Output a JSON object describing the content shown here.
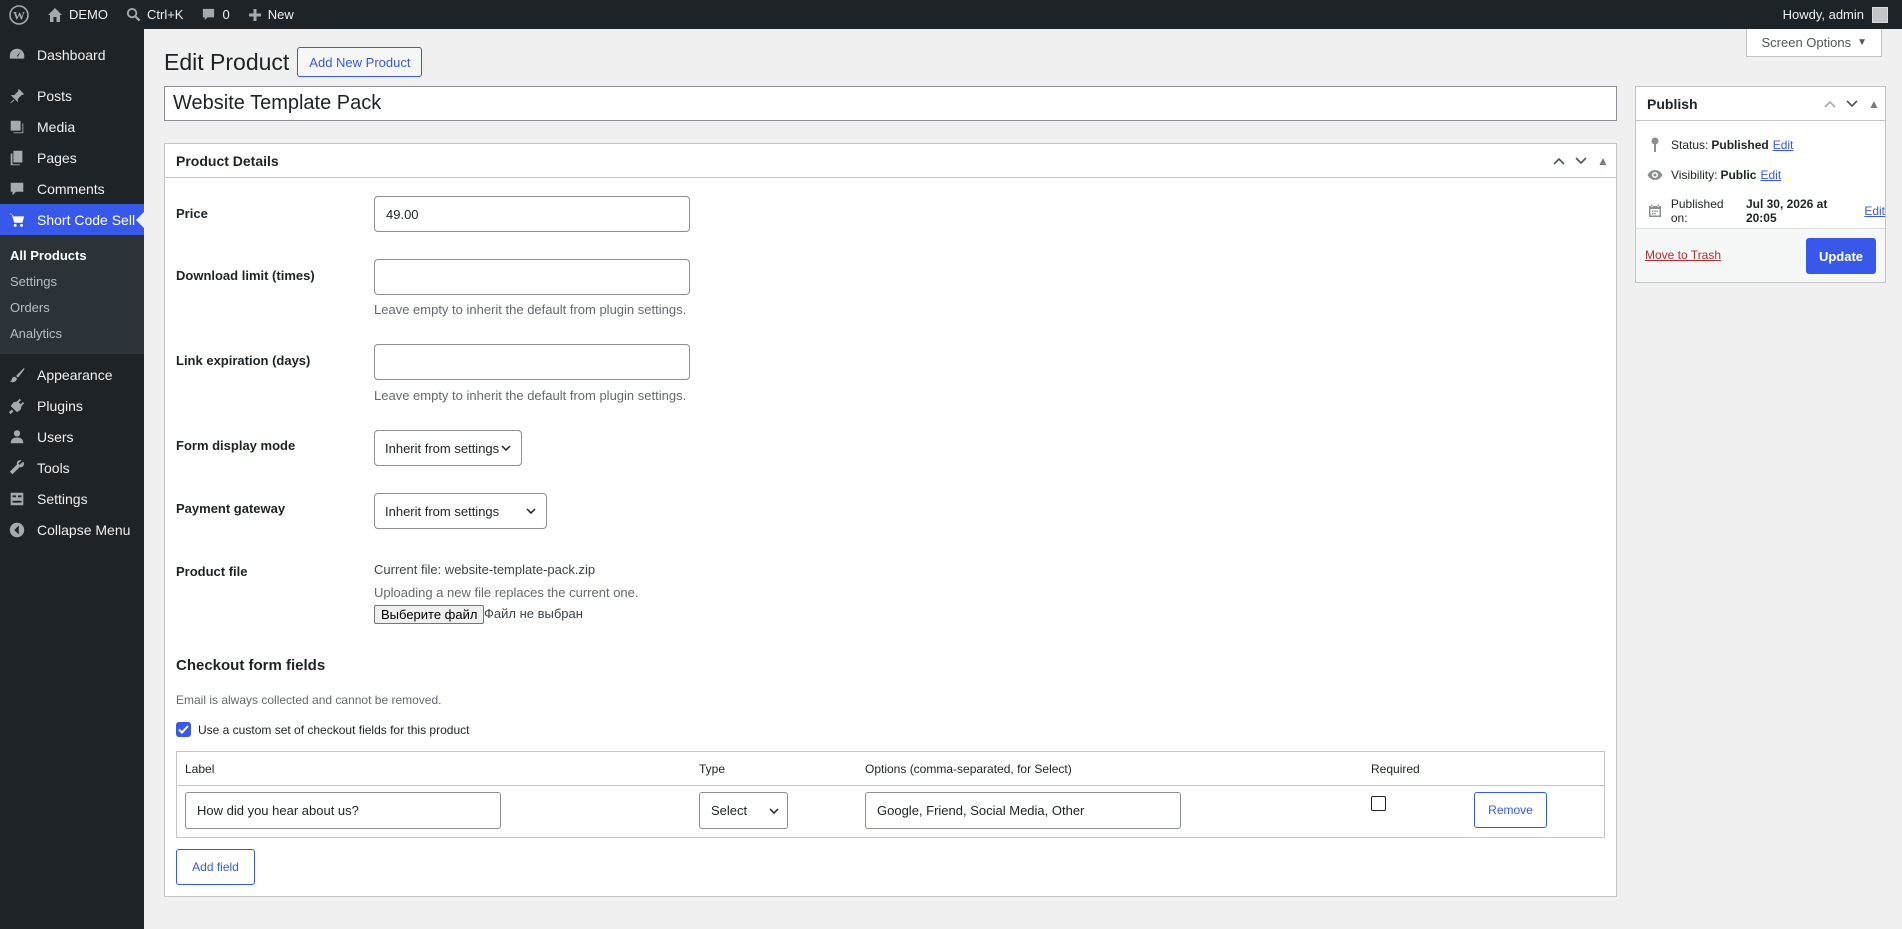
{
  "adminbar": {
    "site_name": "DEMO",
    "shortcut": "Ctrl+K",
    "comments_count": "0",
    "new_label": "New",
    "howdy": "Howdy, admin"
  },
  "sidebar": {
    "items": [
      {
        "label": "Dashboard",
        "icon": "dashboard-icon"
      },
      {
        "label": "Posts",
        "icon": "pin-icon"
      },
      {
        "label": "Media",
        "icon": "media-icon"
      },
      {
        "label": "Pages",
        "icon": "pages-icon"
      },
      {
        "label": "Comments",
        "icon": "comment-icon"
      },
      {
        "label": "Short Code Sell",
        "icon": "cart-icon"
      },
      {
        "label": "Appearance",
        "icon": "brush-icon"
      },
      {
        "label": "Plugins",
        "icon": "plugin-icon"
      },
      {
        "label": "Users",
        "icon": "users-icon"
      },
      {
        "label": "Tools",
        "icon": "wrench-icon"
      },
      {
        "label": "Settings",
        "icon": "settings-icon"
      },
      {
        "label": "Collapse Menu",
        "icon": "collapse-icon"
      }
    ],
    "submenu": [
      "All Products",
      "Settings",
      "Orders",
      "Analytics"
    ]
  },
  "screen_options": "Screen Options",
  "page": {
    "title": "Edit Product",
    "add_new": "Add New Product",
    "post_title": "Website Template Pack"
  },
  "details": {
    "header": "Product Details",
    "price_label": "Price",
    "price_value": "49.00",
    "download_label": "Download limit (times)",
    "download_desc": "Leave empty to inherit the default from plugin settings.",
    "expiration_label": "Link expiration (days)",
    "expiration_desc": "Leave empty to inherit the default from plugin settings.",
    "form_mode_label": "Form display mode",
    "form_mode_value": "Inherit from settings",
    "gateway_label": "Payment gateway",
    "gateway_value": "Inherit from settings",
    "file_label": "Product file",
    "current_file": "Current file: website-template-pack.zip",
    "file_note": "Uploading a new file replaces the current one.",
    "file_button": "Выберите файл",
    "file_none": "Файл не выбран"
  },
  "checkout": {
    "title": "Checkout form fields",
    "desc": "Email is always collected and cannot be removed.",
    "custom_checkbox": "Use a custom set of checkout fields for this product",
    "columns": [
      "Label",
      "Type",
      "Options (comma-separated, for Select)",
      "Required"
    ],
    "row": {
      "label": "How did you hear about us?",
      "type": "Select",
      "options": "Google, Friend, Social Media, Other",
      "remove": "Remove"
    },
    "add_field": "Add field"
  },
  "publish": {
    "header": "Publish",
    "status_label": "Status:",
    "status_value": "Published",
    "visibility_label": "Visibility:",
    "visibility_value": "Public",
    "published_label": "Published on:",
    "published_value": "Jul 30, 2026 at 20:05",
    "edit": "Edit",
    "trash": "Move to Trash",
    "update": "Update"
  },
  "colors": {
    "accent": "#3858e9",
    "adminbar": "#1d2327",
    "background": "#f0f0f1",
    "danger": "#b32d2e"
  }
}
